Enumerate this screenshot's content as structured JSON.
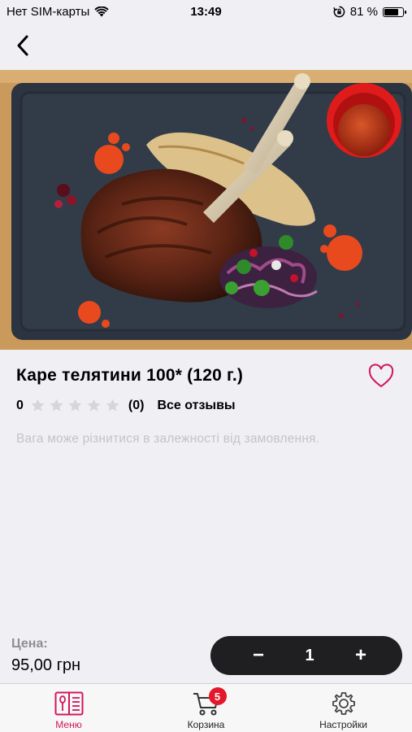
{
  "status_bar": {
    "carrier": "Нет SIM-карты",
    "time": "13:49",
    "battery_percent": "81 %",
    "battery_level": 0.81
  },
  "nav": {
    "back_icon": "chevron-left-icon"
  },
  "product": {
    "title": "Каре телятини 100* (120 г.)",
    "rating_value": "0",
    "rating_stars_filled": 0,
    "rating_stars_total": 5,
    "reviews_count": "(0)",
    "reviews_link": "Все отзывы",
    "note": "Вага може різнитися в залежності від замовлення.",
    "favorite_icon": "heart-outline-icon"
  },
  "price": {
    "label": "Цена:",
    "value": "95,00 грн"
  },
  "quantity": {
    "minus": "−",
    "value": "1",
    "plus": "+"
  },
  "tabs": [
    {
      "label": "Меню",
      "icon": "menu-book-icon",
      "active": true
    },
    {
      "label": "Корзина",
      "icon": "cart-icon",
      "badge": "5"
    },
    {
      "label": "Настройки",
      "icon": "gear-icon"
    }
  ],
  "colors": {
    "accent": "#d3155c",
    "badge": "#e5182b",
    "stepper_bg": "#1f1f21",
    "star_empty": "#d6d6d8",
    "note_text": "#c4c4c8"
  }
}
